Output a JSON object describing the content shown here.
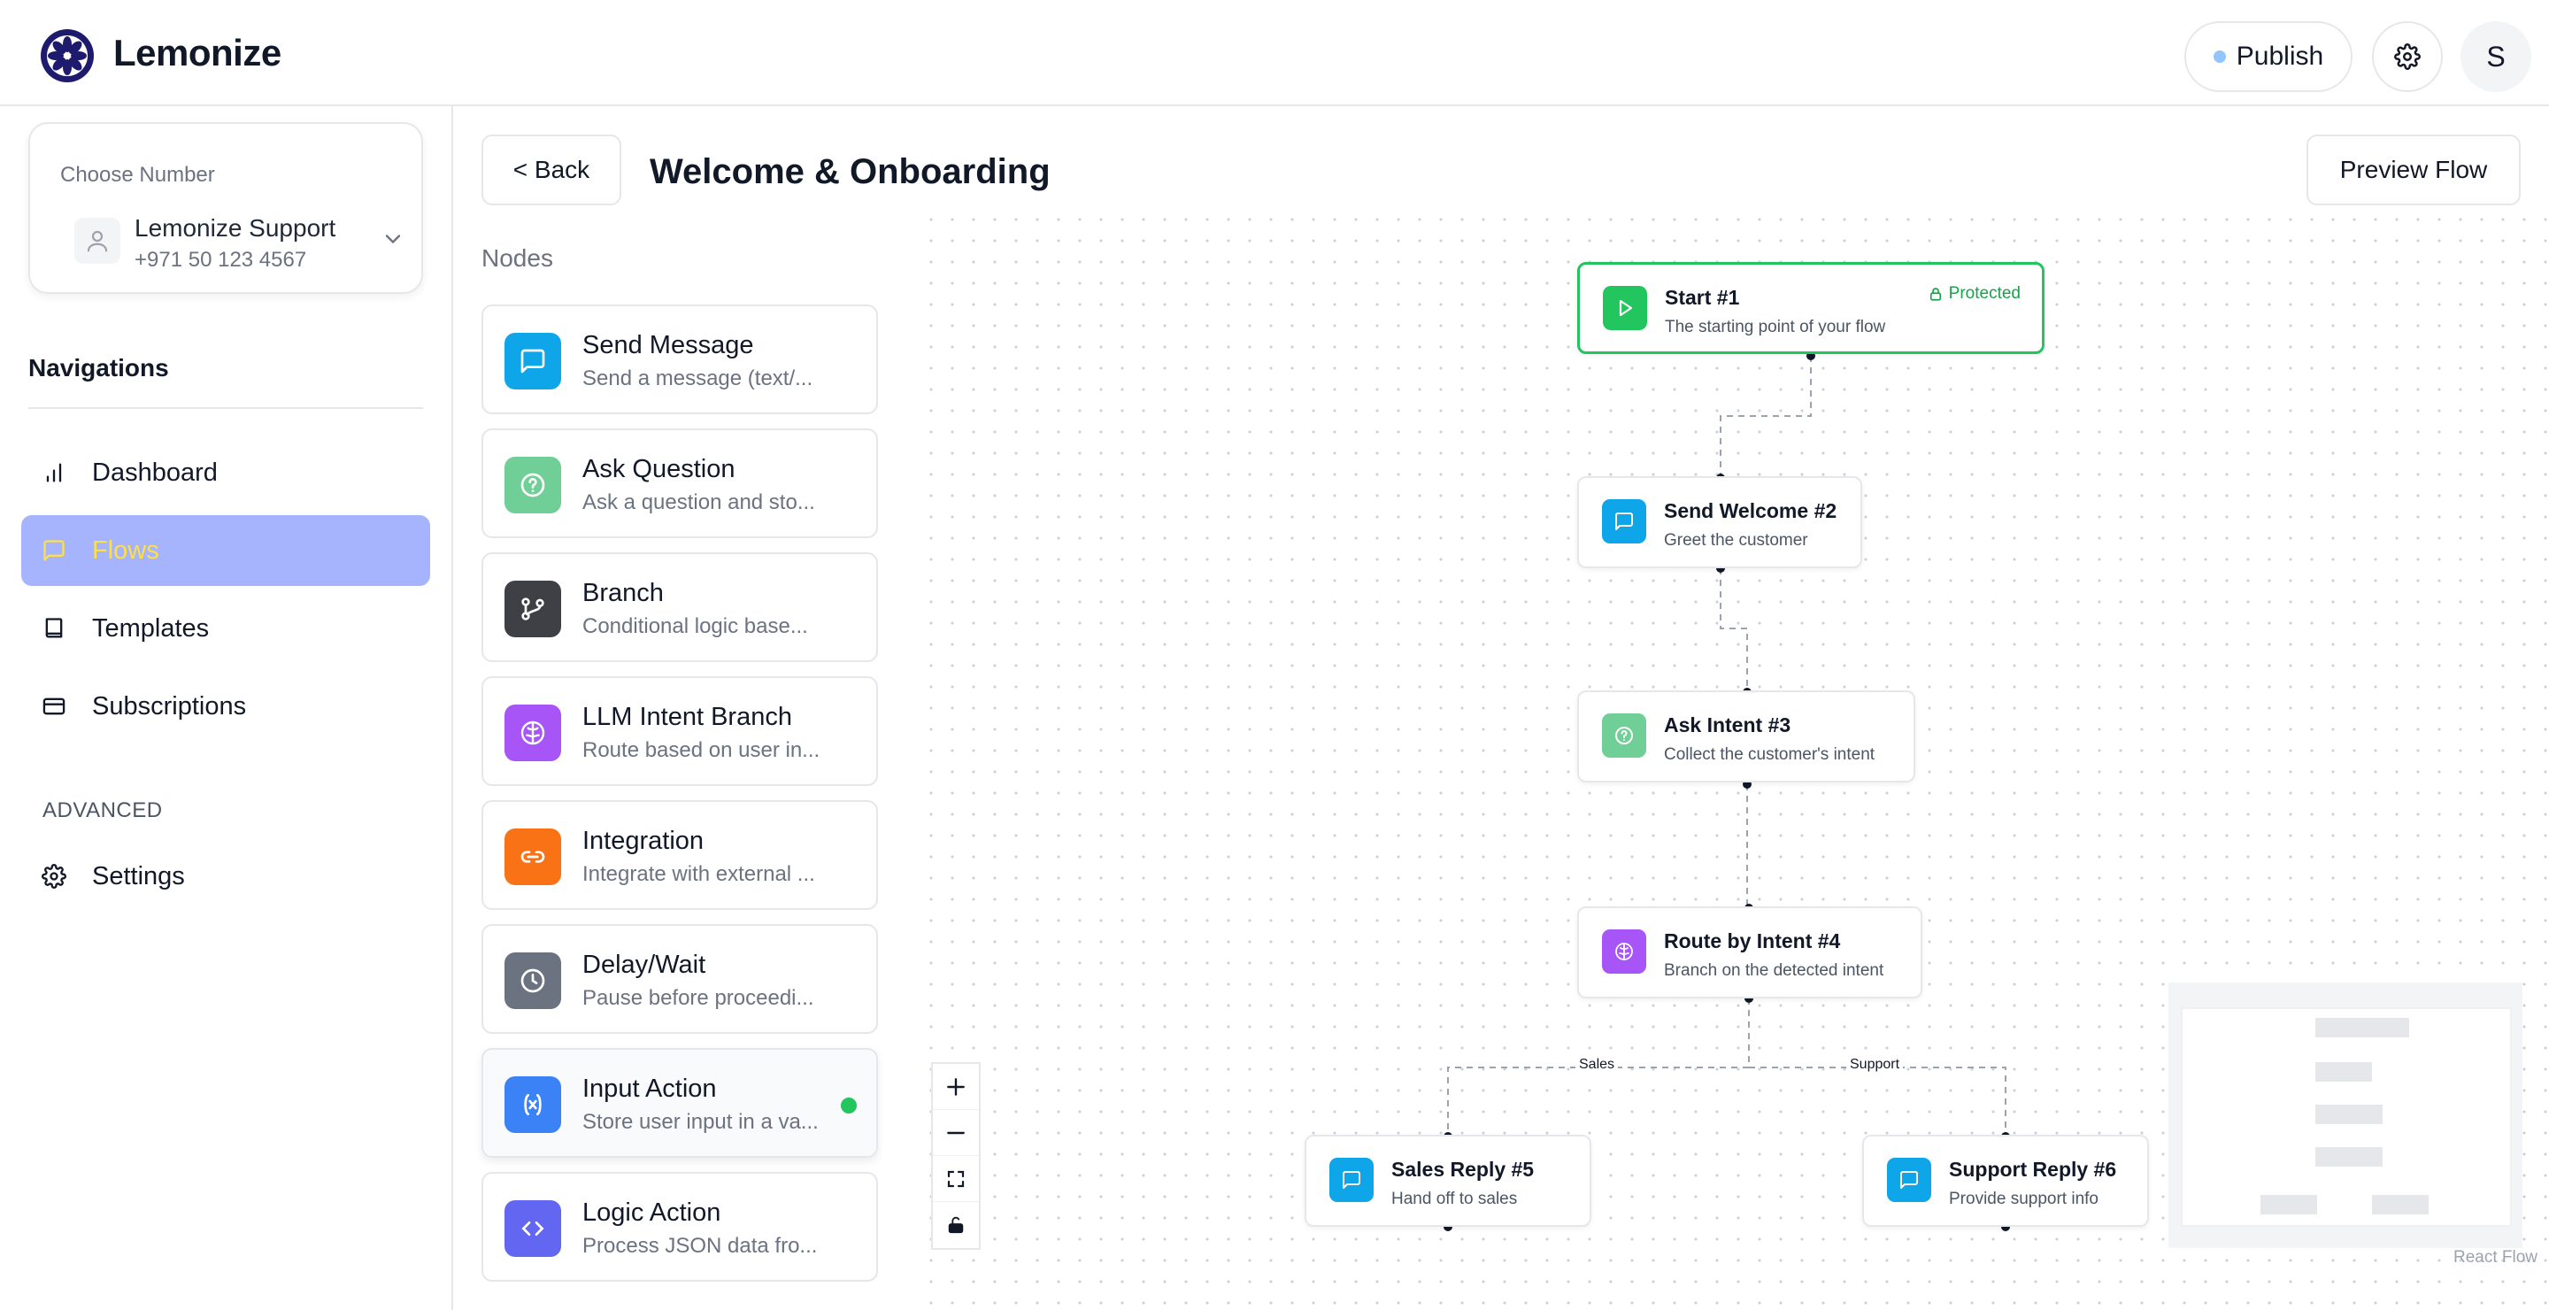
{
  "app": {
    "name": "Lemonize",
    "publish_label": "Publish",
    "avatar_initial": "S"
  },
  "sidebar": {
    "choose_number_label": "Choose Number",
    "selected_number": {
      "name": "Lemonize Support",
      "phone": "+971 50 123 4567"
    },
    "nav_heading": "Navigations",
    "items": [
      {
        "label": "Dashboard",
        "icon": "bar-chart-icon",
        "active": false
      },
      {
        "label": "Flows",
        "icon": "message-icon",
        "active": true
      },
      {
        "label": "Templates",
        "icon": "book-icon",
        "active": false
      },
      {
        "label": "Subscriptions",
        "icon": "credit-card-icon",
        "active": false
      }
    ],
    "advanced_heading": "ADVANCED",
    "advanced_items": [
      {
        "label": "Settings",
        "icon": "gear-icon"
      }
    ]
  },
  "page": {
    "back_label": "< Back",
    "title": "Welcome & Onboarding",
    "preview_label": "Preview Flow"
  },
  "palette": {
    "heading": "Nodes",
    "items": [
      {
        "name": "Send Message",
        "desc": "Send a message (text/...",
        "color": "#0ea5e9",
        "icon": "message-icon"
      },
      {
        "name": "Ask Question",
        "desc": "Ask a question and sto...",
        "color": "#6fcf97",
        "icon": "question-icon"
      },
      {
        "name": "Branch",
        "desc": "Conditional logic base...",
        "color": "#3f3f46",
        "icon": "git-branch-icon"
      },
      {
        "name": "LLM Intent Branch",
        "desc": "Route based on user in...",
        "color": "#a855f7",
        "icon": "brain-icon"
      },
      {
        "name": "Integration",
        "desc": "Integrate with external ...",
        "color": "#f97316",
        "icon": "link-icon"
      },
      {
        "name": "Delay/Wait",
        "desc": "Pause before proceedi...",
        "color": "#6b7280",
        "icon": "clock-icon"
      },
      {
        "name": "Input Action",
        "desc": "Store user input in a va...",
        "color": "#3b82f6",
        "icon": "variable-icon",
        "status": "active"
      },
      {
        "name": "Logic Action",
        "desc": "Process JSON data fro...",
        "color": "#6366f1",
        "icon": "code-icon"
      }
    ]
  },
  "flow": {
    "nodes": [
      {
        "id": "start",
        "title": "Start #1",
        "subtitle": "The starting point of your flow",
        "badge": "Protected",
        "color": "#22c55e",
        "icon": "play-icon"
      },
      {
        "id": "welcome",
        "title": "Send Welcome #2",
        "subtitle": "Greet the customer",
        "color": "#0ea5e9",
        "icon": "message-icon"
      },
      {
        "id": "ask",
        "title": "Ask Intent #3",
        "subtitle": "Collect the customer's intent",
        "color": "#6fcf97",
        "icon": "question-icon"
      },
      {
        "id": "route",
        "title": "Route by Intent #4",
        "subtitle": "Branch on the detected intent",
        "color": "#a855f7",
        "icon": "brain-icon"
      },
      {
        "id": "sales",
        "title": "Sales Reply #5",
        "subtitle": "Hand off to sales",
        "color": "#0ea5e9",
        "icon": "message-icon"
      },
      {
        "id": "support",
        "title": "Support Reply #6",
        "subtitle": "Provide support info",
        "color": "#0ea5e9",
        "icon": "message-icon"
      }
    ],
    "edge_labels": {
      "sales": "Sales",
      "support": "Support"
    },
    "attribution": "React Flow"
  }
}
